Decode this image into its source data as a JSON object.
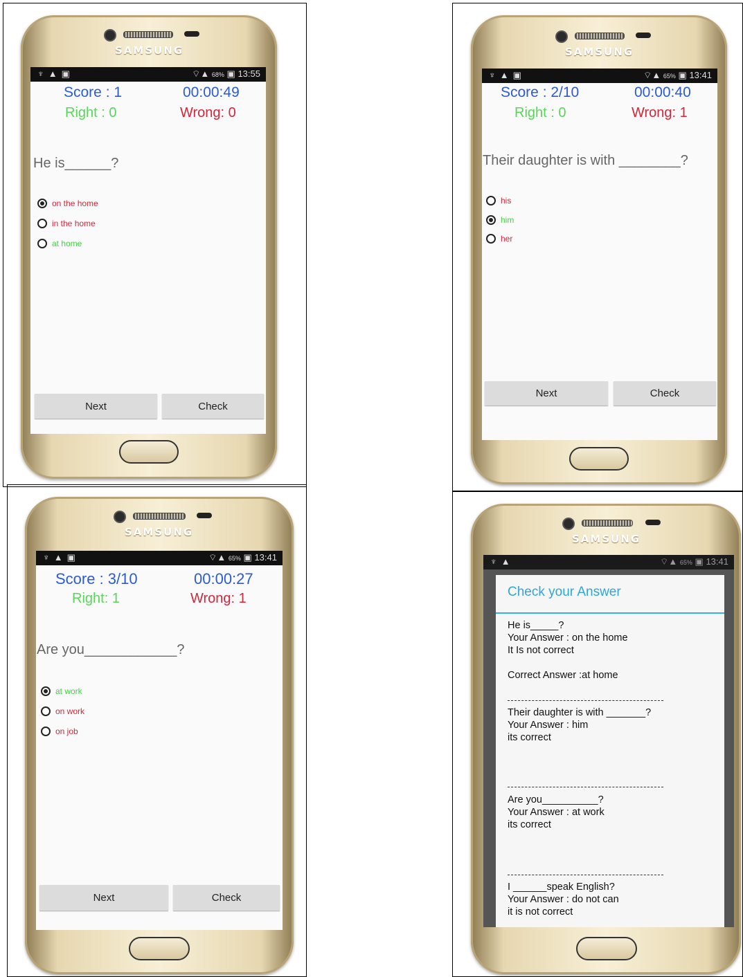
{
  "device_brand": "SAMSUNG",
  "buttons": {
    "next": "Next",
    "check": "Check"
  },
  "screens": [
    {
      "status": {
        "battery": "68%",
        "time": "13:55"
      },
      "score": "Score :  1",
      "timer": "00:00:49",
      "right": "Right :  0",
      "wrong": "Wrong:  0",
      "question": "He is______?",
      "options": [
        {
          "label": "on the home",
          "color": "#d3263a",
          "checked": true
        },
        {
          "label": "in the home",
          "color": "#d3263a",
          "checked": false
        },
        {
          "label": "at home",
          "color": "#45d045",
          "checked": false
        }
      ]
    },
    {
      "status": {
        "battery": "65%",
        "time": "13:41"
      },
      "score": "Score :  2/10",
      "timer": "00:00:40",
      "right": "Right :  0",
      "wrong": "Wrong:  1",
      "question": "Their daughter is with ________?",
      "options": [
        {
          "label": "his",
          "color": "#d3263a",
          "checked": false
        },
        {
          "label": "him",
          "color": "#45d045",
          "checked": true
        },
        {
          "label": "her",
          "color": "#d3263a",
          "checked": false
        }
      ]
    },
    {
      "status": {
        "battery": "65%",
        "time": "13:41"
      },
      "score": "Score :  3/10",
      "timer": "00:00:27",
      "right": "Right:  1",
      "wrong": "Wrong:  1",
      "question": "Are you____________?",
      "options": [
        {
          "label": "at work",
          "color": "#45d045",
          "checked": true
        },
        {
          "label": "on work",
          "color": "#d3263a",
          "checked": false
        },
        {
          "label": "on job",
          "color": "#d3263a",
          "checked": false
        }
      ]
    }
  ],
  "check_dialog": {
    "status": {
      "battery": "65%",
      "time": "13:41"
    },
    "title": "Check your Answer",
    "entries": [
      {
        "lines": [
          "He is_____?",
          "Your Answer : on the home",
          "It Is not correct",
          "",
          "Correct Answer :at home"
        ]
      },
      {
        "lines": [
          "Their daughter is with _______?",
          "Your Answer : him",
          "its correct"
        ]
      },
      {
        "lines": [
          "Are you__________?",
          "Your Answer : at work",
          "its correct"
        ]
      },
      {
        "lines": [
          "I ______speak English?",
          "Your Answer : do not can",
          "it is not correct"
        ]
      }
    ]
  }
}
